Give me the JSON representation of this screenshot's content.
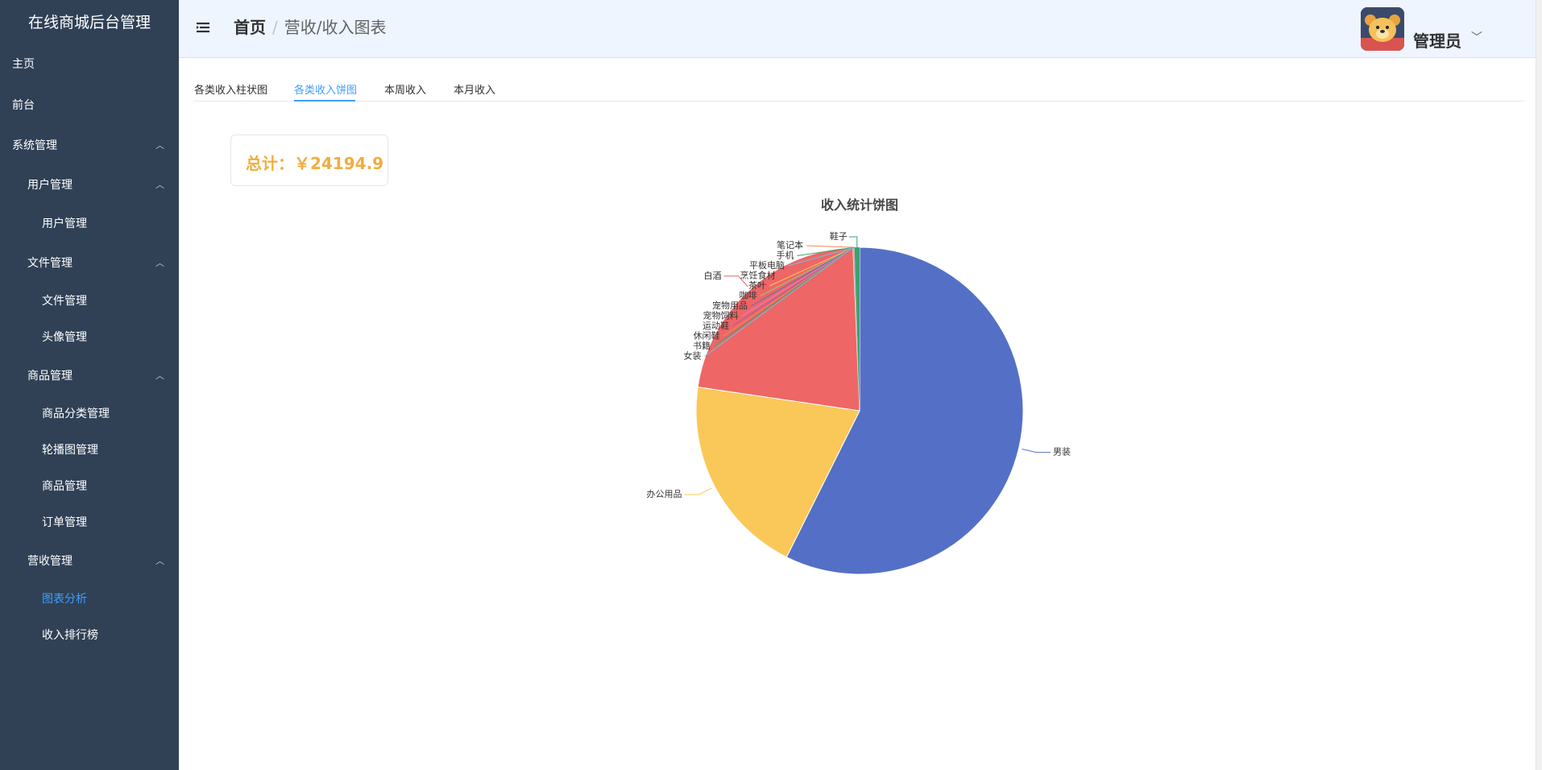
{
  "sidebar": {
    "title": "在线商城后台管理",
    "items": [
      {
        "label": "主页"
      },
      {
        "label": "前台"
      },
      {
        "label": "系统管理"
      },
      {
        "label": "用户管理"
      },
      {
        "label": "用户管理"
      },
      {
        "label": "文件管理"
      },
      {
        "label": "文件管理"
      },
      {
        "label": "头像管理"
      },
      {
        "label": "商品管理"
      },
      {
        "label": "商品分类管理"
      },
      {
        "label": "轮播图管理"
      },
      {
        "label": "商品管理"
      },
      {
        "label": "订单管理"
      },
      {
        "label": "营收管理"
      },
      {
        "label": "图表分析"
      },
      {
        "label": "收入排行榜"
      }
    ]
  },
  "header": {
    "breadcrumb_home": "首页",
    "breadcrumb_current": "营收/收入图表",
    "username": "管理员"
  },
  "tabs": [
    {
      "label": "各类收入柱状图"
    },
    {
      "label": "各类收入饼图"
    },
    {
      "label": "本周收入"
    },
    {
      "label": "本月收入"
    }
  ],
  "active_tab": "各类收入饼图",
  "total": {
    "text": "总计：￥24194.9"
  },
  "chart_data": {
    "type": "pie",
    "title": "收入统计饼图",
    "slices": [
      {
        "name": "男装",
        "value": 13800,
        "color": "#5470c6"
      },
      {
        "name": "办公用品",
        "value": 4800,
        "color": "#fac858"
      },
      {
        "name": "白酒",
        "value": 5300,
        "color": "#ee6666"
      },
      {
        "name": "女装",
        "value": 3,
        "color": "#73c0de"
      },
      {
        "name": "书籍",
        "value": 3,
        "color": "#3ba272"
      },
      {
        "name": "休闲鞋",
        "value": 3,
        "color": "#fc8452"
      },
      {
        "name": "运动鞋",
        "value": 3,
        "color": "#9a60b4"
      },
      {
        "name": "宠物饲料",
        "value": 3,
        "color": "#ea7ccc"
      },
      {
        "name": "宠物用品",
        "value": 3,
        "color": "#5470c6"
      },
      {
        "name": "咖啡",
        "value": 3,
        "color": "#91cc75"
      },
      {
        "name": "茶叶",
        "value": 3,
        "color": "#fac858"
      },
      {
        "name": "烹饪食材",
        "value": 3,
        "color": "#ee6666"
      },
      {
        "name": "平板电脑",
        "value": 3,
        "color": "#73c0de"
      },
      {
        "name": "手机",
        "value": 3,
        "color": "#3ba272"
      },
      {
        "name": "笔记本",
        "value": 3,
        "color": "#fc8452"
      },
      {
        "name": "鞋子",
        "value": 120,
        "color": "#3ba272"
      }
    ]
  },
  "colors": {
    "sidebar_bg": "#304156",
    "accent": "#409eff",
    "total_text": "#f0ad3e"
  }
}
